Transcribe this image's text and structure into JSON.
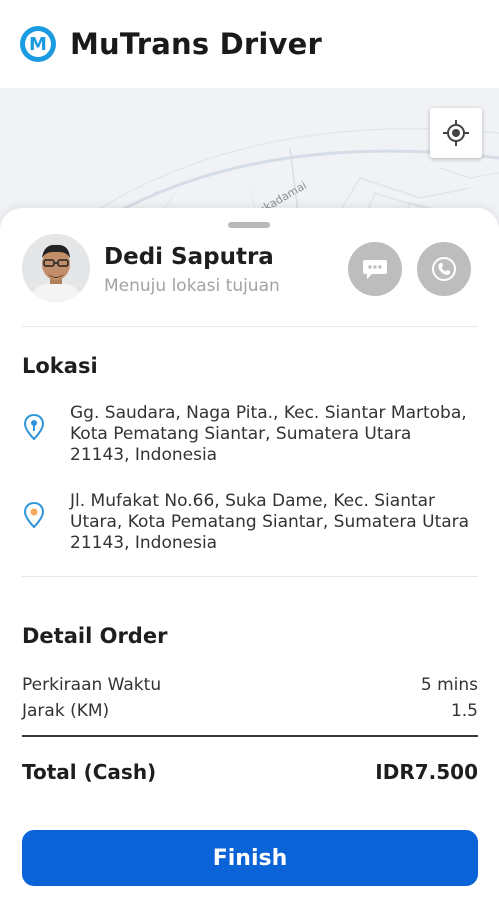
{
  "app": {
    "title": "MuTrans Driver",
    "logo_letter": "M",
    "accent_color": "#1a9ae0"
  },
  "map": {
    "street_label": "Jl. Sukadamai",
    "locate_icon": "crosshair-icon"
  },
  "driver": {
    "name": "Dedi Saputra",
    "status": "Menuju lokasi tujuan",
    "chat_icon": "chat-bubble-icon",
    "call_icon": "phone-icon"
  },
  "location": {
    "title": "Lokasi",
    "pickup": "Gg. Saudara, Naga Pita., Kec. Siantar Martoba, Kota Pematang Siantar, Sumatera Utara 21143, Indonesia",
    "destination": "Jl. Mufakat No.66, Suka Dame, Kec. Siantar Utara, Kota Pematang Siantar, Sumatera Utara 21143, Indonesia"
  },
  "order": {
    "title": "Detail Order",
    "rows": [
      {
        "label": "Perkiraan Waktu",
        "value": "5 mins"
      },
      {
        "label": "Jarak (KM)",
        "value": "1.5"
      }
    ],
    "total_label": "Total (Cash)",
    "total_value": "IDR7.500"
  },
  "actions": {
    "finish_label": "Finish",
    "finish_color": "#0b63d8"
  }
}
